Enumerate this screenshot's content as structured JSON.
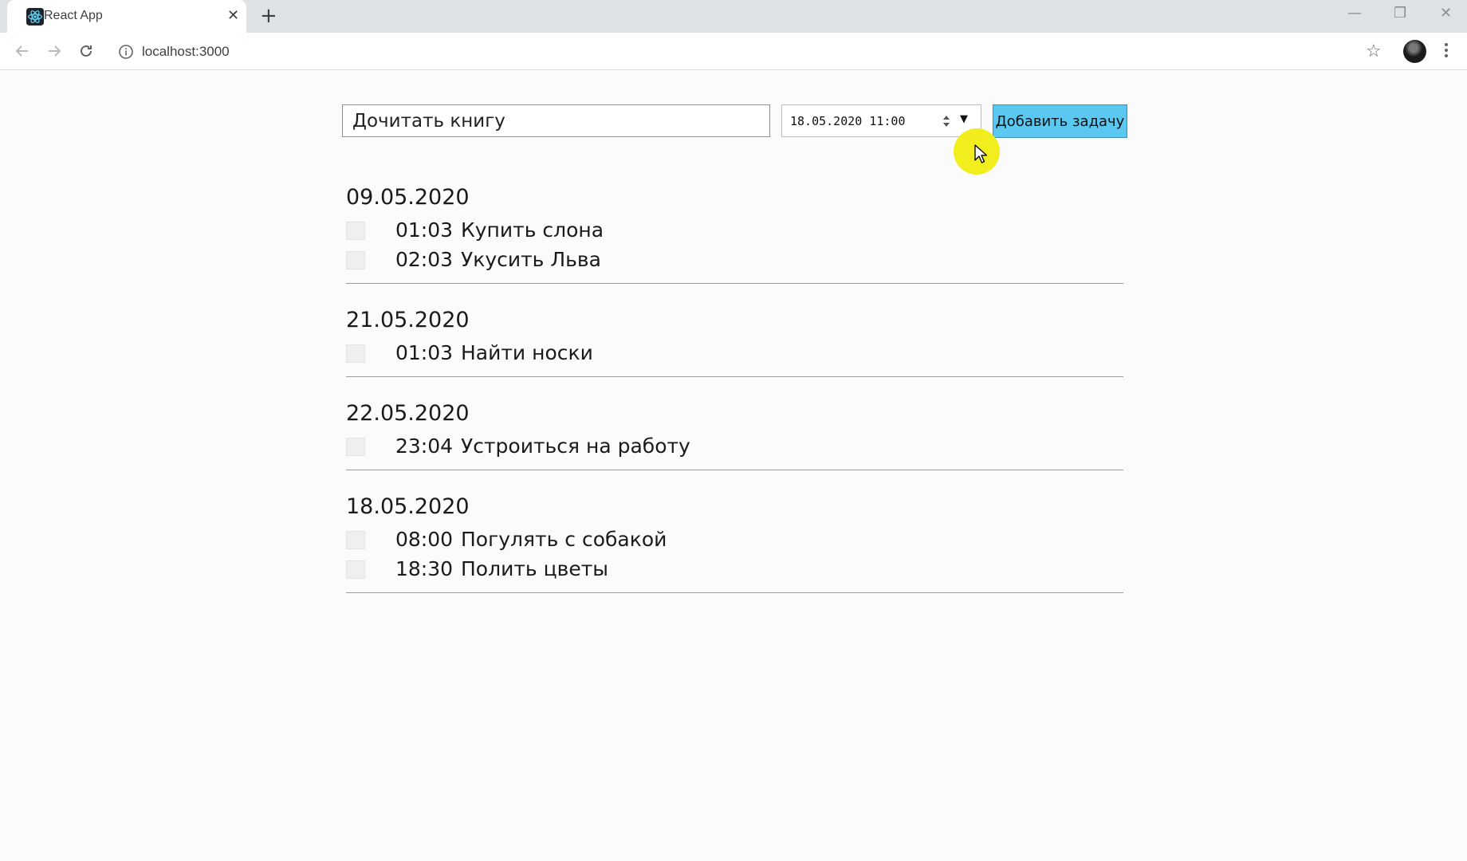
{
  "browser": {
    "tab_title": "React App",
    "url": "localhost:3000"
  },
  "form": {
    "task_value": "Дочитать книгу",
    "datetime_value": "18.05.2020 11:00",
    "add_button_label": "Добавить задачу"
  },
  "groups": [
    {
      "date": "09.05.2020",
      "tasks": [
        {
          "time": "01:03",
          "title": "Купить слона"
        },
        {
          "time": "02:03",
          "title": "Укусить Льва"
        }
      ]
    },
    {
      "date": "21.05.2020",
      "tasks": [
        {
          "time": "01:03",
          "title": "Найти носки"
        }
      ]
    },
    {
      "date": "22.05.2020",
      "tasks": [
        {
          "time": "23:04",
          "title": "Устроиться на работу"
        }
      ]
    },
    {
      "date": "18.05.2020",
      "tasks": [
        {
          "time": "08:00",
          "title": "Погулять с собакой"
        },
        {
          "time": "18:30",
          "title": "Полить цветы"
        }
      ]
    }
  ],
  "colors": {
    "add_button": "#5ac8f0",
    "cursor_highlight": "#f1ec10",
    "page_background": "#fbfbfb"
  }
}
